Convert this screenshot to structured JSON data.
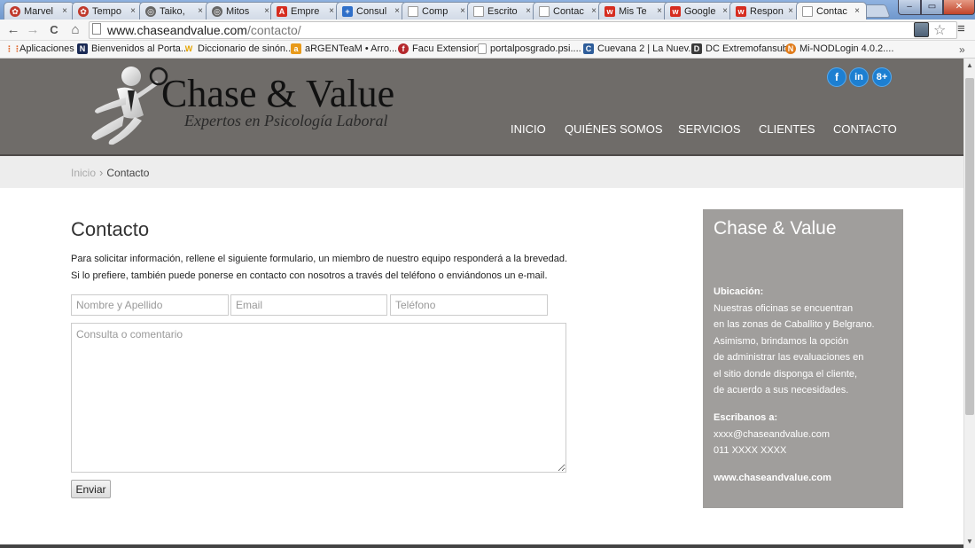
{
  "browser": {
    "tabs": [
      {
        "label": "Marvel",
        "icon": "red-pinwheel-icon",
        "color": "#c0392b"
      },
      {
        "label": "Tempo",
        "icon": "red-pinwheel-icon",
        "color": "#c0392b"
      },
      {
        "label": "Taiko,",
        "icon": "gray-globe-icon",
        "color": "#666666"
      },
      {
        "label": "Mitos",
        "icon": "gray-globe-icon",
        "color": "#666666"
      },
      {
        "label": "Empre",
        "icon": "red-a-icon",
        "color": "#d62d20"
      },
      {
        "label": "Consul",
        "icon": "blue-cross-icon",
        "color": "#2f6fc9"
      },
      {
        "label": "Comp",
        "icon": "page-icon",
        "color": "#999999"
      },
      {
        "label": "Escrito",
        "icon": "page-icon",
        "color": "#999999"
      },
      {
        "label": "Contac",
        "icon": "page-icon",
        "color": "#999999"
      },
      {
        "label": "Mis Te",
        "icon": "red-w-icon",
        "color": "#d62d20"
      },
      {
        "label": "Google",
        "icon": "red-w-icon",
        "color": "#d62d20"
      },
      {
        "label": "Respon",
        "icon": "red-w-icon",
        "color": "#d62d20"
      },
      {
        "label": "Contac",
        "icon": "page-icon",
        "color": "#999999",
        "active": true
      }
    ],
    "tab_close": "×",
    "window_controls": {
      "min": "–",
      "max": "▭",
      "close": "✕"
    },
    "nav": {
      "back": "←",
      "forward": "→",
      "reload": "C",
      "home": "⌂",
      "star": "☆",
      "menu": "≡"
    },
    "url_host": "www.chaseandvalue.com",
    "url_path": "/contacto/",
    "bookmarks": [
      {
        "label": "Aplicaciones",
        "icon": "apps-grid-icon",
        "color": "#e0662a"
      },
      {
        "label": "Bienvenidos al Porta...",
        "icon": "n-logo-icon",
        "color": "#1a2a55"
      },
      {
        "label": "Diccionario de sinón...",
        "icon": "wr-logo-icon",
        "color": "#e5a400"
      },
      {
        "label": "aRGENTeaM • Arro...",
        "icon": "argenteam-icon",
        "color": "#e89a1a"
      },
      {
        "label": "Facu Extension",
        "icon": "facu-icon",
        "color": "#b5282c"
      },
      {
        "label": "portalposgrado.psi....",
        "icon": "page-icon",
        "color": "#999999"
      },
      {
        "label": "Cuevana 2 | La Nuev...",
        "icon": "cuevana-icon",
        "color": "#2e5d9a"
      },
      {
        "label": "DC Extremofansub",
        "icon": "dc-icon",
        "color": "#3a3a3a"
      },
      {
        "label": "Mi-NODLogin 4.0.2....",
        "icon": "nod-icon",
        "color": "#e07b1a"
      }
    ],
    "bookmarks_more": "»"
  },
  "site": {
    "logo_title": "Chase & Value",
    "logo_tagline": "Expertos en Psicología Laboral",
    "social": [
      {
        "label": "f",
        "icon": "facebook-icon"
      },
      {
        "label": "in",
        "icon": "linkedin-icon"
      },
      {
        "label": "8+",
        "icon": "google-plus-icon"
      }
    ],
    "nav": [
      "INICIO",
      "QUIÉNES SOMOS",
      "SERVICIOS",
      "CLIENTES",
      "CONTACTO"
    ],
    "breadcrumb": {
      "home": "Inicio",
      "separator": "›",
      "current": "Contacto"
    }
  },
  "form": {
    "title": "Contacto",
    "intro_line1": "Para solicitar información, rellene el siguiente formulario, un miembro de nuestro equipo responderá a la brevedad.",
    "intro_line2": "Si lo prefiere, también puede ponerse en contacto con nosotros a través del teléfono o enviándonos un e-mail.",
    "name_placeholder": "Nombre y Apellido",
    "email_placeholder": "Email",
    "phone_placeholder": "Teléfono",
    "message_placeholder": "Consulta o comentario",
    "submit_label": "Enviar"
  },
  "info_card": {
    "title": "Chase & Value",
    "location_heading": "Ubicación:",
    "location_lines": [
      "Nuestras oficinas se encuentran",
      "en las zonas de Caballito y Belgrano.",
      "Asimismo, brindamos la opción",
      "de administrar las evaluaciones en",
      "el sitio donde disponga el cliente,",
      "de acuerdo a sus necesidades."
    ],
    "contact_heading": "Escribanos a:",
    "email": "xxxx@chaseandvalue.com",
    "phone": "011 XXXX XXXX",
    "website": "www.chaseandvalue.com"
  },
  "colors": {
    "header_bg": "#6f6c69",
    "card_bg": "#a09e9c",
    "social_blue": "#1d7fd1"
  }
}
